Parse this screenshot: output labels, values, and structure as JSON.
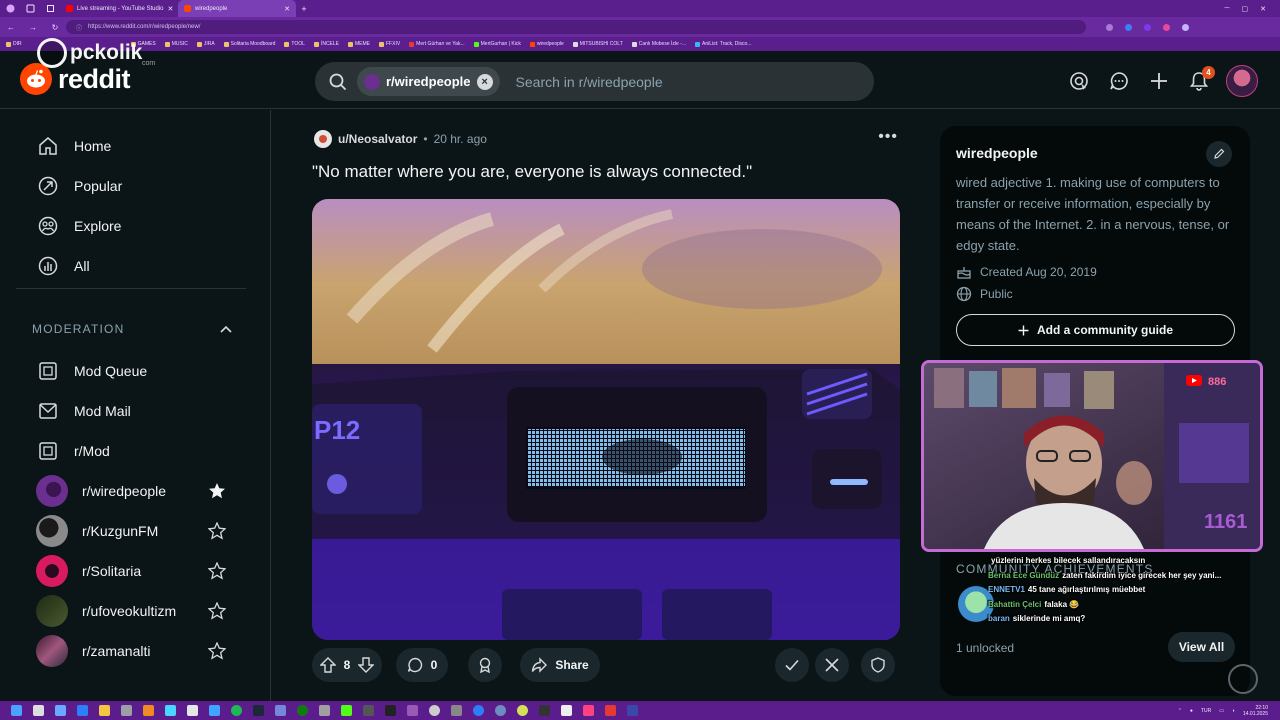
{
  "browser": {
    "tabs": [
      {
        "title": "Live streaming - YouTube Studio",
        "active": false,
        "color": "#ff0000"
      },
      {
        "title": "wiredpeople",
        "active": true,
        "color": "#ff4500"
      }
    ],
    "url": "https://www.reddit.com/r/wiredpeople/new/",
    "bookmarks": [
      "DIR",
      "GAMES",
      "MUSIC",
      "JIRA",
      "Solitaria Moodboard",
      "TOOL",
      "İNCELE",
      "MEME",
      "FFXIV",
      "Mert Gürhan ve Yak...",
      "MertGurhan | Kick",
      "wiredpeople",
      "MITSUBISHI COLT",
      "Canlı Mobese İzle -...",
      "AniList: Track, Disco..."
    ]
  },
  "watermark": {
    "text": "pckolik",
    "sub": "com"
  },
  "header": {
    "logo_text": "reddit",
    "search_chip": "r/wiredpeople",
    "search_placeholder": "Search in r/wiredpeople",
    "notification_count": "4"
  },
  "sidebar": {
    "nav": [
      {
        "label": "Home",
        "icon": "home-icon"
      },
      {
        "label": "Popular",
        "icon": "popular-icon"
      },
      {
        "label": "Explore",
        "icon": "explore-icon"
      },
      {
        "label": "All",
        "icon": "all-icon"
      }
    ],
    "moderation_heading": "MODERATION",
    "mod_items": [
      {
        "label": "Mod Queue",
        "icon": "mod-queue-icon"
      },
      {
        "label": "Mod Mail",
        "icon": "mod-mail-icon"
      },
      {
        "label": "r/Mod",
        "icon": "mod-icon"
      }
    ],
    "communities": [
      {
        "label": "r/wiredpeople",
        "favorited": true,
        "color": "#5b2d7a"
      },
      {
        "label": "r/KuzgunFM",
        "favorited": false,
        "color": "#5a5a5a"
      },
      {
        "label": "r/Solitaria",
        "favorited": false,
        "color": "#c2185b"
      },
      {
        "label": "r/ufoveokultizm",
        "favorited": false,
        "color": "#3b4a2a"
      },
      {
        "label": "r/zamanalti",
        "favorited": false,
        "color": "#6a3b5a"
      }
    ]
  },
  "post": {
    "author": "u/Neosalvator",
    "time": "20 hr. ago",
    "title": "\"No matter where you are, everyone is always connected.\"",
    "votes": "8",
    "comments": "0",
    "share_label": "Share"
  },
  "community": {
    "name": "wiredpeople",
    "description": "wired adjective 1. making use of computers to transfer or receive information, especially by means of the Internet. 2. in a nervous, tense, or edgy state.",
    "created": "Created Aug 20, 2019",
    "visibility": "Public",
    "guide_button": "Add a community guide",
    "achievements_title": "COMMUNITY ACHIEVEMENTS",
    "unlocked": "1 unlocked",
    "view_all": "View All"
  },
  "stream_chat": [
    {
      "user": "",
      "msg": "yüzlerini herkes bilecek sallandıracaksın"
    },
    {
      "user": "Berna Ece Gündüz",
      "msg": "zaten fakirdim iyice girecek her şey yani..."
    },
    {
      "user": "ENNETV1",
      "msg": "45 tane ağırlaştırılmış müebbet"
    },
    {
      "user": "Bahattin Çelci",
      "msg": "falaka 😂"
    },
    {
      "user": "baran",
      "msg": "siklerinde mi amq?"
    }
  ],
  "taskbar": {
    "lang": "TUR",
    "time": "22:10",
    "date": "14.01.2025"
  },
  "colors": {
    "accent": "#ff4500",
    "bg": "#0b1416",
    "chrome": "#5a1f8c"
  }
}
